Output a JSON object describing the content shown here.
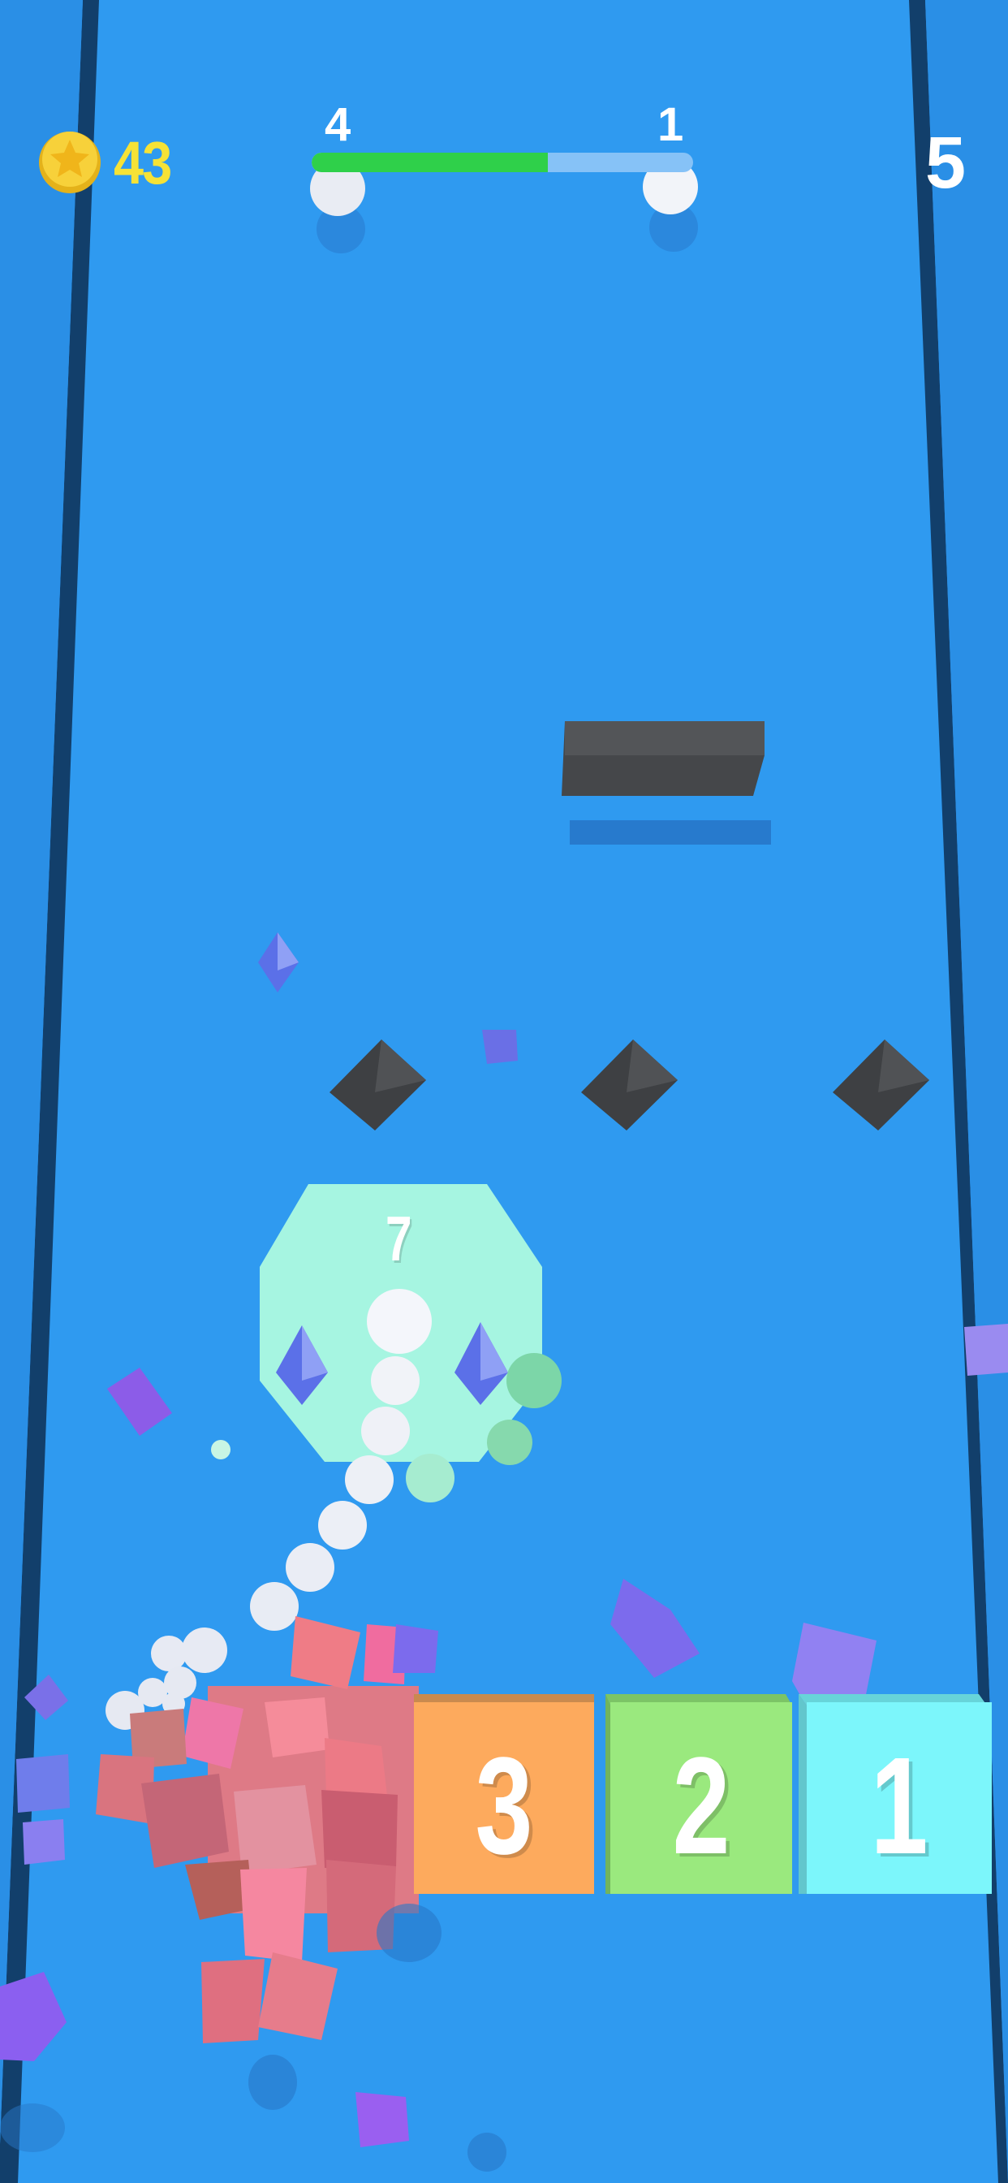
{
  "hud": {
    "coin_icon": "star-coin-icon",
    "coin_count": "43",
    "level_number": "5",
    "progress": {
      "left_number": "4",
      "right_number": "1",
      "fill_fraction": 0.62
    }
  },
  "crowd": {
    "count": "7"
  },
  "blocks": [
    {
      "label": "3",
      "color": "#fdaa5d"
    },
    {
      "label": "2",
      "color": "#9ae97e"
    },
    {
      "label": "1",
      "color": "#7cf6fb"
    }
  ],
  "colors": {
    "track": "#2f9af0",
    "rail": "#123f6b",
    "coin_text": "#f6e236",
    "progress_green": "#2fd04a",
    "crowd_zone": "#a6f5e1",
    "obstacle": "#3f4144"
  }
}
